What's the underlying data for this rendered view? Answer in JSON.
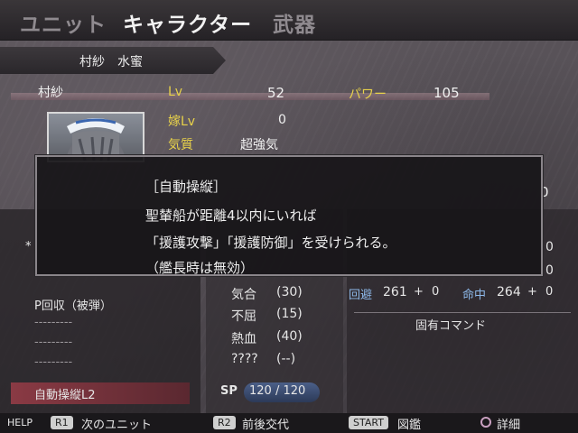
{
  "header": {
    "tabs": [
      {
        "label": "ユニット",
        "state": "inactive"
      },
      {
        "label": "キャラクター",
        "state": "active"
      },
      {
        "label": "武器",
        "state": "inactive"
      }
    ]
  },
  "unit_name_bar": {
    "text": "村紗　水蜜"
  },
  "character": {
    "name": "村紗",
    "lv_label": "Lv",
    "lv_value": "52",
    "power_label": "パワー",
    "power_value": "105",
    "yome_lv_label": "嫁Lv",
    "yome_lv_value": "0",
    "temperament_label": "気質",
    "temperament_value": "超強気"
  },
  "partial_values": {
    "right_edge_0": "0",
    "r1": "0",
    "r2": "0",
    "r3": "0"
  },
  "left_skills": {
    "star": "*",
    "items": [
      "P回収（被弾）",
      "---------",
      "---------",
      "---------"
    ],
    "selected": "自動操縦L2"
  },
  "spirit_commands": {
    "items": [
      {
        "name": "気合",
        "cost": "(30)"
      },
      {
        "name": "不屈",
        "cost": "(15)"
      },
      {
        "name": "熱血",
        "cost": "(40)"
      },
      {
        "name": "????",
        "cost": "(--)"
      }
    ],
    "sp_label": "SP",
    "sp_value": "120 / 120"
  },
  "right_stats": {
    "evade_label": "回避",
    "evade_value": "261",
    "hit_label": "命中",
    "hit_value": "264",
    "plus": "+",
    "bonus_a": "0",
    "bonus_b": "0",
    "unique_command_label": "固有コマンド"
  },
  "popup": {
    "title": "［自動操縦］",
    "lines": [
      "聖輦船が距離4以内にいれば",
      "「援護攻撃」「援護防御」を受けられる。",
      "（艦長時は無効）"
    ]
  },
  "footer": {
    "help": "HELP",
    "r1_button": "R1",
    "r1_text": "次のユニット",
    "r2_button": "R2",
    "r2_text": "前後交代",
    "start_button": "START",
    "start_text": "図鑑",
    "circle_text": "詳細"
  },
  "colors": {
    "label_yellow": "#e8d24a",
    "selected_skill": "#8a3a44",
    "sp_gauge": "#3c4f78"
  }
}
